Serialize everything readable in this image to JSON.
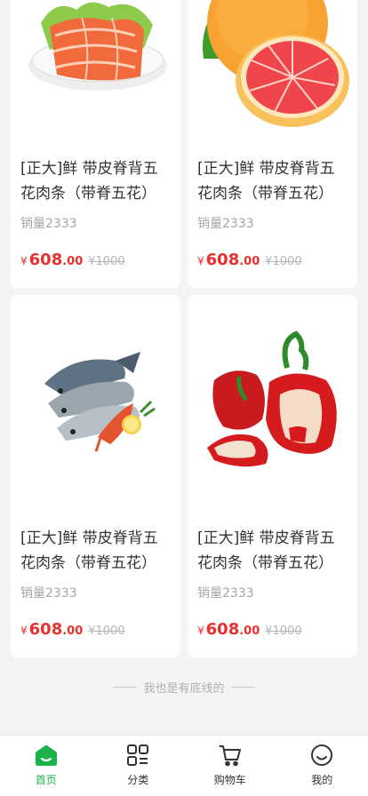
{
  "products": [
    {
      "image": "salmon-slices-on-plate",
      "title": "[正大]鲜 带皮脊背五花肉条（带脊五花）",
      "sales": "销量2333",
      "currency": "¥",
      "price_int": "608",
      "price_dec": ".00",
      "old_price": "¥1000"
    },
    {
      "image": "grapefruit",
      "title": "[正大]鲜 带皮脊背五花肉条（带脊五花）",
      "sales": "销量2333",
      "currency": "¥",
      "price_int": "608",
      "price_dec": ".00",
      "old_price": "¥1000"
    },
    {
      "image": "fish-and-shrimp",
      "title": "[正大]鲜 带皮脊背五花肉条（带脊五花）",
      "sales": "销量2333",
      "currency": "¥",
      "price_int": "608",
      "price_dec": ".00",
      "old_price": "¥1000"
    },
    {
      "image": "red-bell-peppers",
      "title": "[正大]鲜 带皮脊背五花肉条（带脊五花）",
      "sales": "销量2333",
      "currency": "¥",
      "price_int": "608",
      "price_dec": ".00",
      "old_price": "¥1000"
    }
  ],
  "end_note": "我也是有底线的",
  "tabbar": {
    "items": [
      {
        "label": "首页",
        "icon": "home-icon",
        "active": true
      },
      {
        "label": "分类",
        "icon": "category-icon",
        "active": false
      },
      {
        "label": "购物车",
        "icon": "cart-icon",
        "active": false
      },
      {
        "label": "我的",
        "icon": "profile-icon",
        "active": false
      }
    ]
  },
  "colors": {
    "accent": "#19b34a",
    "price": "#e8312f",
    "old_price": "#b5b5b5",
    "background": "#f4f4f4"
  }
}
